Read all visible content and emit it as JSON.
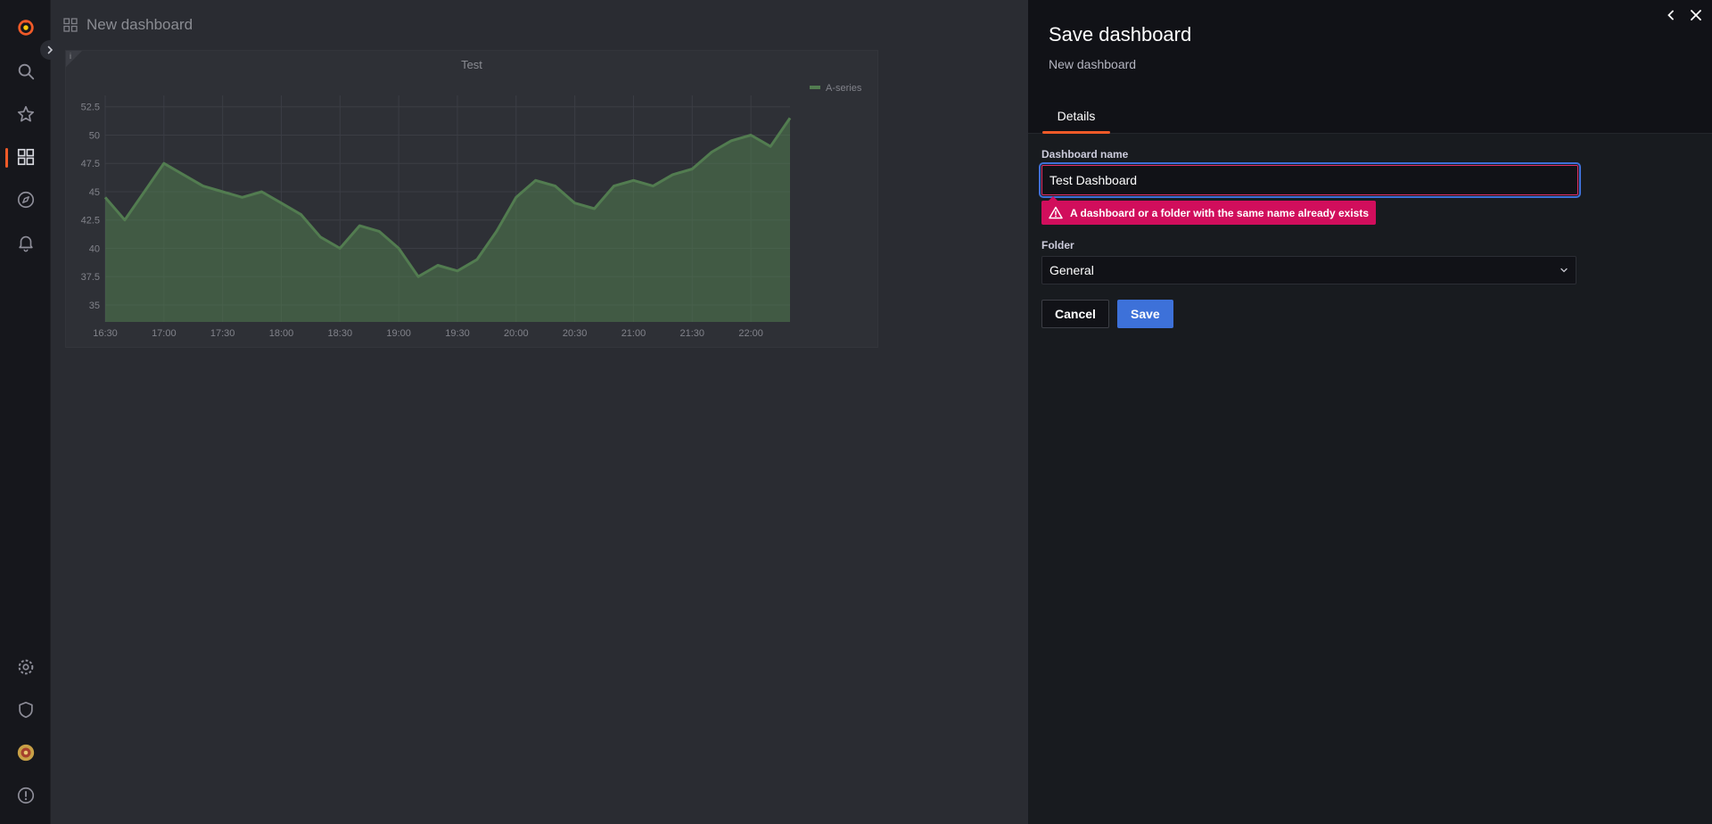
{
  "dashboard": {
    "title": "New dashboard",
    "panel": {
      "title": "Test",
      "info_icon": "i"
    }
  },
  "chart_data": {
    "type": "area",
    "title": "Test",
    "series": [
      {
        "name": "A-series",
        "color": "#73bf69",
        "x": [
          "16:30",
          "16:40",
          "16:50",
          "17:00",
          "17:10",
          "17:20",
          "17:30",
          "17:40",
          "17:50",
          "18:00",
          "18:10",
          "18:20",
          "18:30",
          "18:40",
          "18:50",
          "19:00",
          "19:10",
          "19:20",
          "19:30",
          "19:40",
          "19:50",
          "20:00",
          "20:10",
          "20:20",
          "20:30",
          "20:40",
          "20:50",
          "21:00",
          "21:10",
          "21:20",
          "21:30",
          "21:40",
          "21:50",
          "22:00",
          "22:10",
          "22:20"
        ],
        "values": [
          44.5,
          42.5,
          45,
          47.5,
          46.5,
          45.5,
          45,
          44.5,
          45,
          44,
          43,
          41,
          40,
          42,
          41.5,
          40,
          37.5,
          38.5,
          38,
          39,
          41.5,
          44.5,
          46,
          45.5,
          44,
          43.5,
          45.5,
          46,
          45.5,
          46.5,
          47,
          48.5,
          49.5,
          50,
          49,
          51.5
        ]
      }
    ],
    "x_tick_labels": [
      "16:30",
      "17:00",
      "17:30",
      "18:00",
      "18:30",
      "19:00",
      "19:30",
      "20:00",
      "20:30",
      "21:00",
      "21:30",
      "22:00"
    ],
    "y_tick_labels": [
      "35",
      "37.5",
      "40",
      "42.5",
      "45",
      "47.5",
      "50",
      "52.5"
    ],
    "ylim": [
      33.5,
      53.5
    ],
    "grid": true,
    "legend": "top-right"
  },
  "drawer": {
    "title": "Save dashboard",
    "subtitle": "New dashboard",
    "tabs": [
      {
        "label": "Details",
        "active": true
      }
    ],
    "form": {
      "name_label": "Dashboard name",
      "name_value": "Test Dashboard",
      "error": "A dashboard or a folder with the same name already exists",
      "folder_label": "Folder",
      "folder_value": "General"
    },
    "buttons": {
      "cancel": "Cancel",
      "save": "Save"
    }
  },
  "colors": {
    "accent": "#f05a28",
    "primary": "#3d71d9",
    "error": "#d10e5c",
    "series": "#73bf69"
  }
}
